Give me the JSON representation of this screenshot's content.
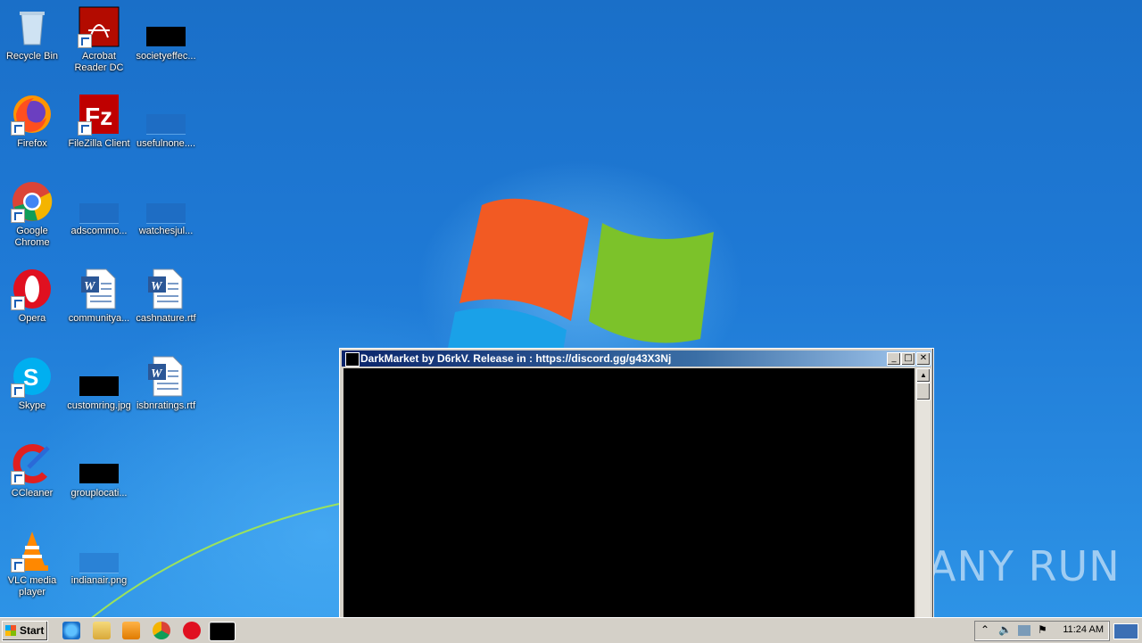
{
  "desktop": {
    "icons": [
      {
        "label": "Recycle Bin"
      },
      {
        "label": "Acrobat Reader DC"
      },
      {
        "label": "societyeffec..."
      },
      {
        "label": "Firefox"
      },
      {
        "label": "FileZilla Client"
      },
      {
        "label": "usefulnone...."
      },
      {
        "label": "Google Chrome"
      },
      {
        "label": "adscommo..."
      },
      {
        "label": "watchesjul..."
      },
      {
        "label": "Opera"
      },
      {
        "label": "communitya..."
      },
      {
        "label": "cashnature.rtf"
      },
      {
        "label": "Skype"
      },
      {
        "label": "customring.jpg"
      },
      {
        "label": "isbnratings.rtf"
      },
      {
        "label": "CCleaner"
      },
      {
        "label": "grouplocati..."
      },
      {
        "label": "VLC media player"
      },
      {
        "label": "indianair.png"
      }
    ],
    "watermark": "ANY RUN"
  },
  "window": {
    "title": "DarkMarket by D6rkV. Release in : https://discord.gg/g43X3Nj",
    "minimize": "_",
    "maximize": "□",
    "close": "✕"
  },
  "taskbar": {
    "start_label": "Start",
    "clock": "11:24 AM",
    "pinned": [
      "internet-explorer-icon",
      "explorer-icon",
      "media-player-icon",
      "chrome-icon",
      "opera-icon",
      "console-app-icon"
    ]
  }
}
